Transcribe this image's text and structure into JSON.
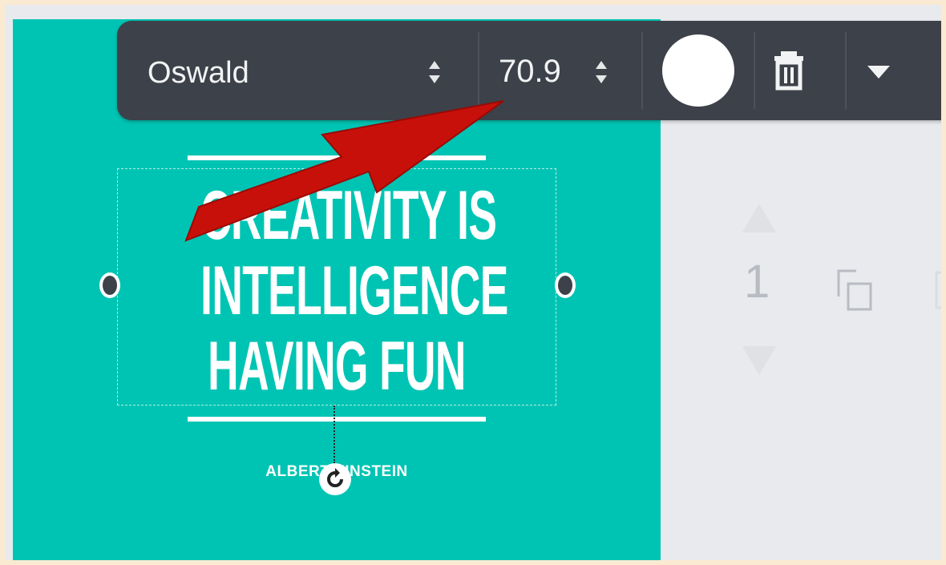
{
  "toolbar": {
    "font_family": "Oswald",
    "font_size": "70.9",
    "text_color": "#ffffff"
  },
  "design": {
    "quote_lines": [
      "CREATIVITY IS",
      "INTELLIGENCE",
      "HAVING FUN"
    ],
    "author": "ALBERT EINSTEIN",
    "background_color": "#00c4b3"
  },
  "page_controls": {
    "page_number": "1"
  },
  "icons": {
    "font_stepper": "up-down-chevron-icon",
    "size_stepper": "up-down-chevron-icon",
    "trash": "trash-icon",
    "dropdown": "caret-down-icon",
    "rotate": "rotate-icon",
    "copy": "copy-page-icon",
    "page_up": "chevron-up-icon",
    "page_down": "chevron-down-icon"
  },
  "annotation": {
    "arrow_color": "#c8100b"
  }
}
